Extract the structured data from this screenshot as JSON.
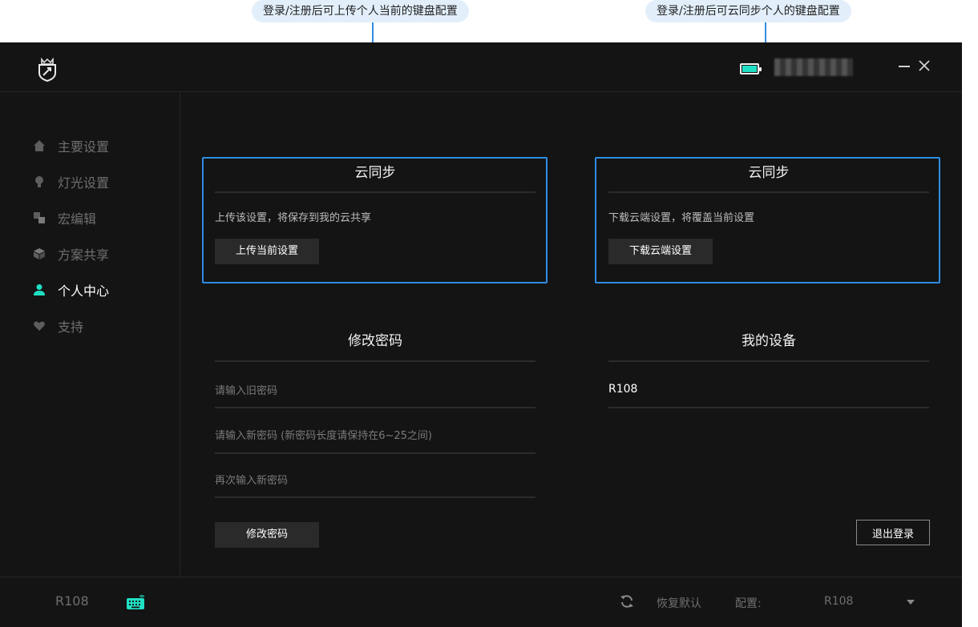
{
  "annotations": {
    "left": "登录/注册后可上传个人当前的键盘配置",
    "right": "登录/注册后可云同步个人的键盘配置"
  },
  "titlebar": {
    "logo_icon": "crown-shield-logo-icon",
    "battery_icon": "battery-icon",
    "battery_level": 1.0,
    "minimize_icon": "minimize-icon",
    "close_icon": "close-icon"
  },
  "sidebar": {
    "items": [
      {
        "label": "主要设置",
        "icon": "home-icon",
        "active": false
      },
      {
        "label": "灯光设置",
        "icon": "bulb-icon",
        "active": false
      },
      {
        "label": "宏编辑",
        "icon": "macro-icon",
        "active": false
      },
      {
        "label": "方案共享",
        "icon": "cube-icon",
        "active": false
      },
      {
        "label": "个人中心",
        "icon": "user-icon",
        "active": true
      },
      {
        "label": "支持",
        "icon": "heart-icon",
        "active": false
      }
    ]
  },
  "upload_card": {
    "title": "云同步",
    "description": "上传该设置，将保存到我的云共享",
    "button": "上传当前设置"
  },
  "download_card": {
    "title": "云同步",
    "description": "下载云端设置，将覆盖当前设置",
    "button": "下载云端设置"
  },
  "password": {
    "title": "修改密码",
    "old_placeholder": "请输入旧密码",
    "new_placeholder": "请输入新密码 (新密码长度请保持在6~25之间)",
    "confirm_placeholder": "再次输入新密码",
    "button": "修改密码"
  },
  "devices": {
    "title": "我的设备",
    "items": [
      "R108"
    ],
    "logout": "退出登录"
  },
  "bottombar": {
    "device": "R108",
    "restore_label": "恢复默认",
    "config_label": "配置:",
    "config_value": "R108"
  },
  "colors": {
    "accent_teal": "#1fe0c4",
    "highlight_blue": "#2f8de4",
    "background": "#141414"
  }
}
